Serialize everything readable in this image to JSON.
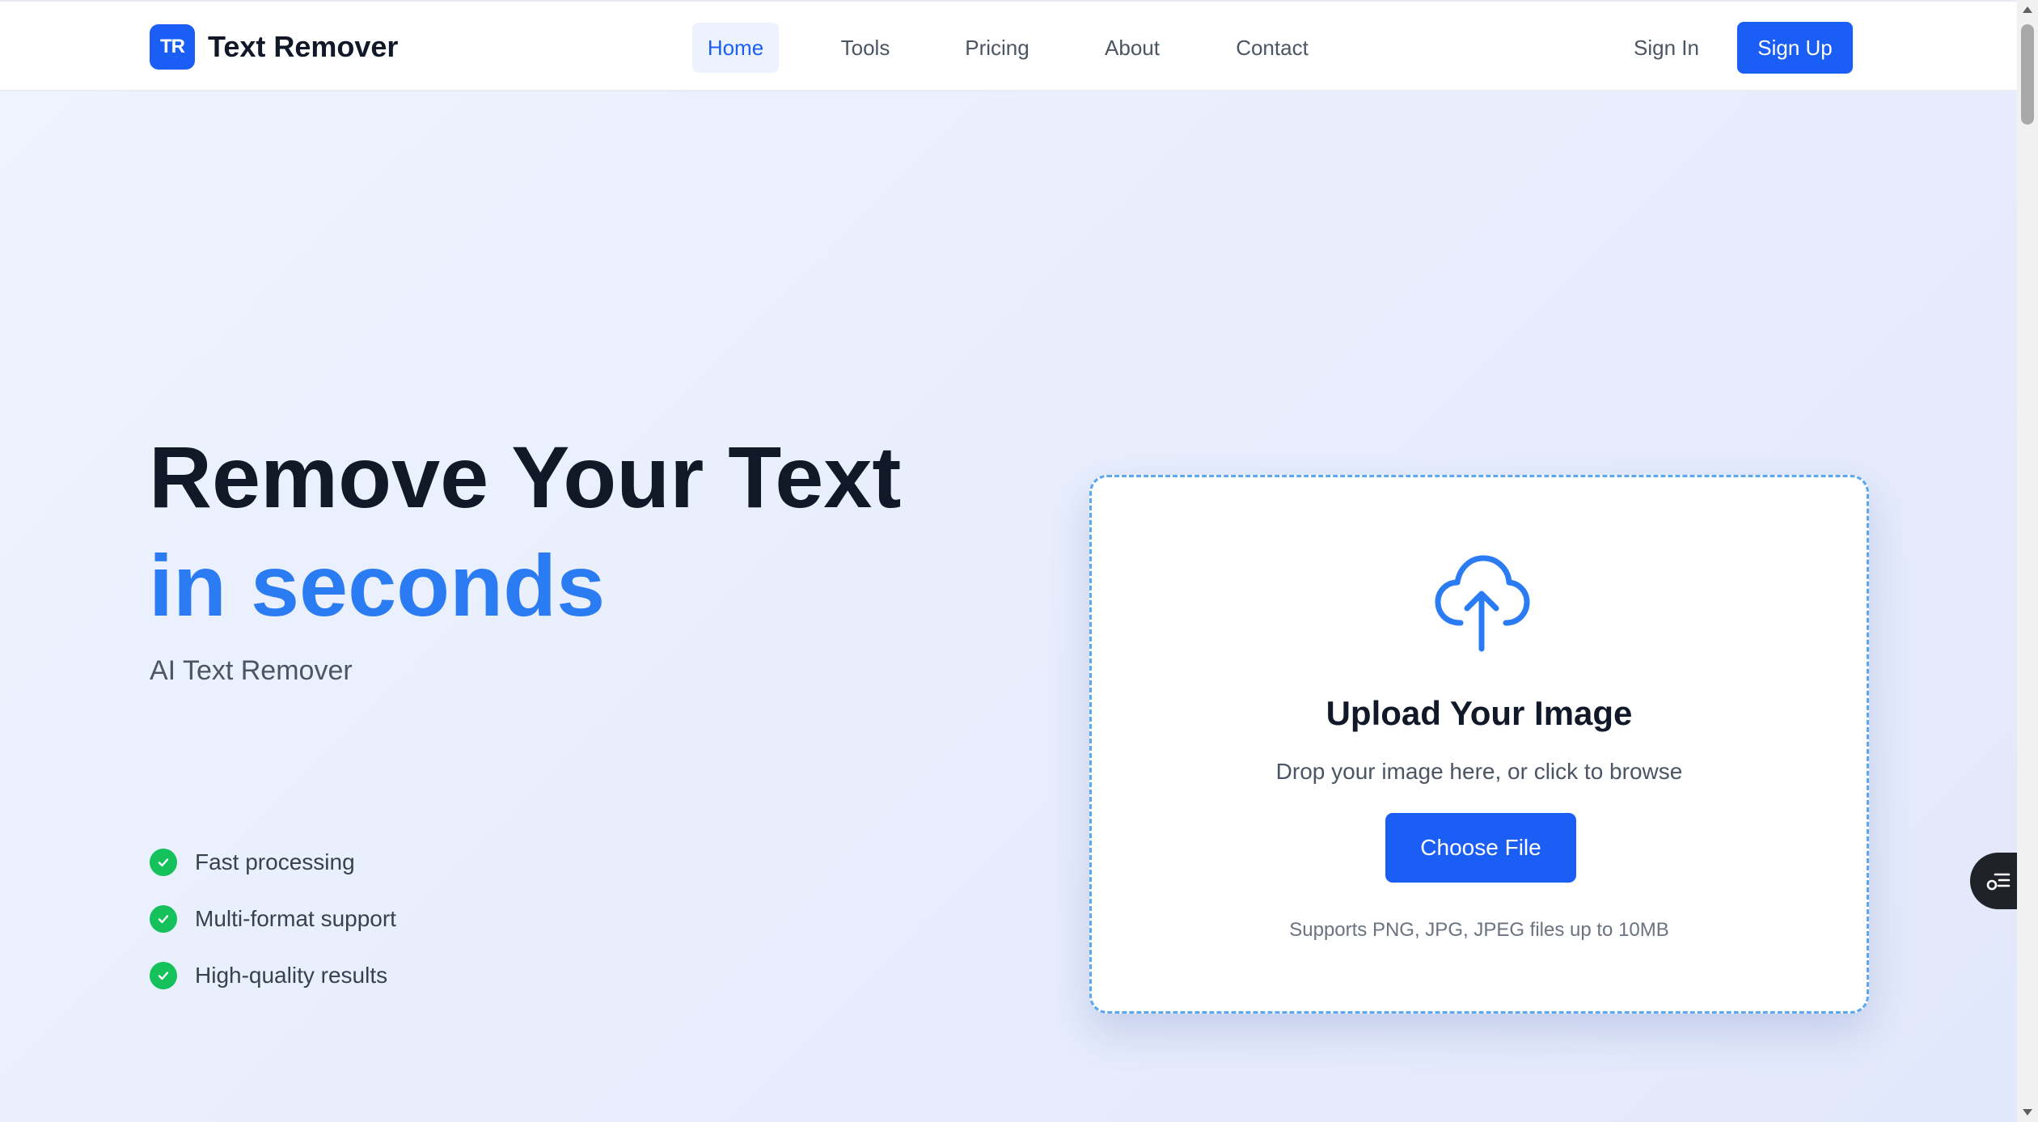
{
  "header": {
    "logo_badge": "TR",
    "logo_text": "Text Remover",
    "nav": [
      "Home",
      "Tools",
      "Pricing",
      "About",
      "Contact"
    ],
    "active_nav": "Home",
    "sign_in": "Sign In",
    "sign_up": "Sign Up"
  },
  "hero": {
    "headline_line1": "Remove Your Text",
    "headline_line2": "in seconds",
    "subheadline": "AI Text Remover",
    "features": [
      "Fast processing",
      "Multi-format support",
      "High-quality results"
    ]
  },
  "upload": {
    "icon": "cloud-upload-icon",
    "title": "Upload Your Image",
    "description": "Drop your image here, or click to browse",
    "button_label": "Choose File",
    "note": "Supports PNG, JPG, JPEG files up to 10MB"
  },
  "colors": {
    "primary": "#1b5ef5",
    "accent": "#2b7cf3",
    "success": "#14c15a",
    "text_dark": "#111827"
  }
}
